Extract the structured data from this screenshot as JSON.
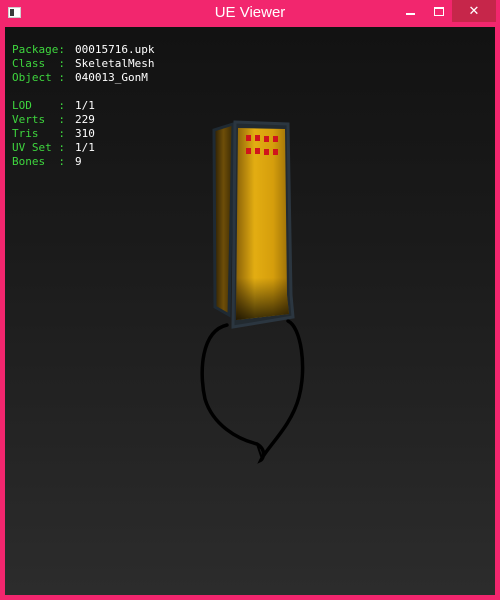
{
  "window": {
    "title": "UE Viewer",
    "minimize_icon": "minimize-icon",
    "maximize_icon": "maximize-icon",
    "close_icon": "close-icon",
    "close_glyph": "✕",
    "accent_color": "#f2266e"
  },
  "info": {
    "package": {
      "label": "Package:",
      "value": "00015716.upk"
    },
    "class": {
      "label": "Class  :",
      "value": "SkeletalMesh"
    },
    "object": {
      "label": "Object :",
      "value": "040013_GonM"
    },
    "lod": {
      "label": "LOD    :",
      "value": "1/1"
    },
    "verts": {
      "label": "Verts  :",
      "value": "229"
    },
    "tris": {
      "label": "Tris   :",
      "value": "310"
    },
    "uvset": {
      "label": "UV Set :",
      "value": "1/1"
    },
    "bones": {
      "label": "Bones  :",
      "value": "9"
    }
  },
  "colors": {
    "label_color": "#3ed63e",
    "value_color": "#ffffff",
    "mesh_yellow": "#e0a910",
    "mesh_red": "#d0141c"
  }
}
